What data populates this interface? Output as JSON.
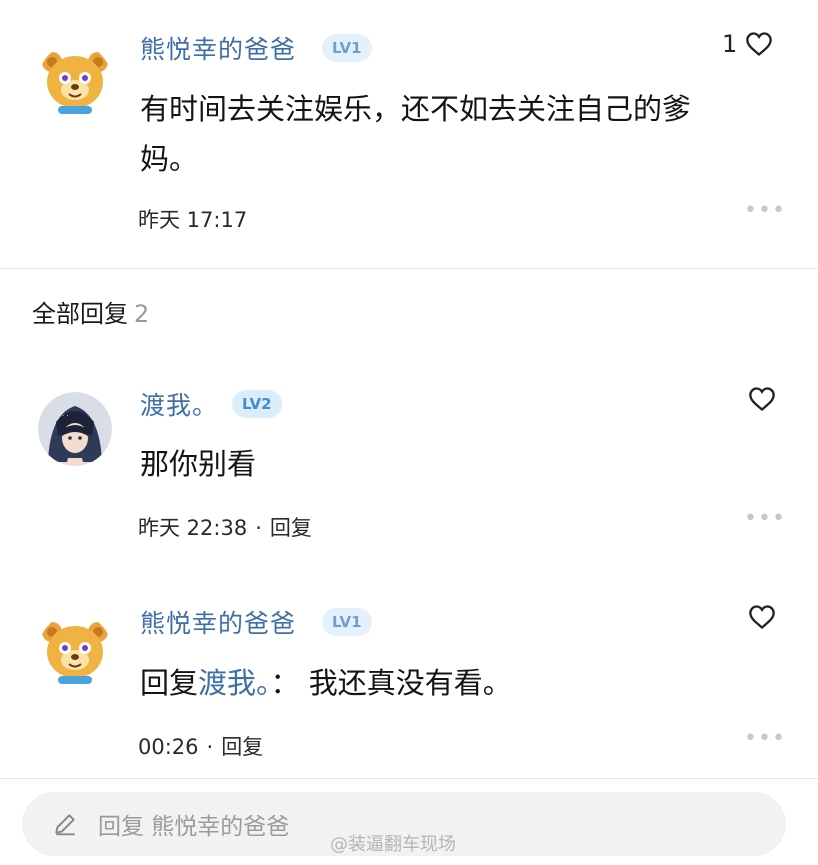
{
  "main_comment": {
    "username": "熊悦幸的爸爸",
    "level": "LV1",
    "like_count": "1",
    "text_line1": "有时间去关注娱乐，还不如去关注自己的爹",
    "text_line2": "妈。",
    "time": "昨天 17:17"
  },
  "replies_section": {
    "title": "全部回复",
    "count": "2"
  },
  "replies": [
    {
      "username": "渡我。",
      "level": "LV2",
      "text": "那你别看",
      "time": "昨天 22:38",
      "reply_label": "回复"
    },
    {
      "username": "熊悦幸的爸爸",
      "level": "LV1",
      "text_prefix": "回复",
      "mention": "渡我。",
      "text_suffix": "： 我还真没有看。",
      "time": "00:26",
      "reply_label": "回复"
    }
  ],
  "reply_bar": {
    "placeholder": "回复 熊悦幸的爸爸"
  },
  "watermark": "@装逼翻车现场",
  "icons": {
    "like": "heart-outline-icon",
    "more": "more-dots-icon",
    "edit": "pencil-icon"
  },
  "colors": {
    "username": "#3f6fa8",
    "level_badge_bg": "#e4f1fb"
  }
}
